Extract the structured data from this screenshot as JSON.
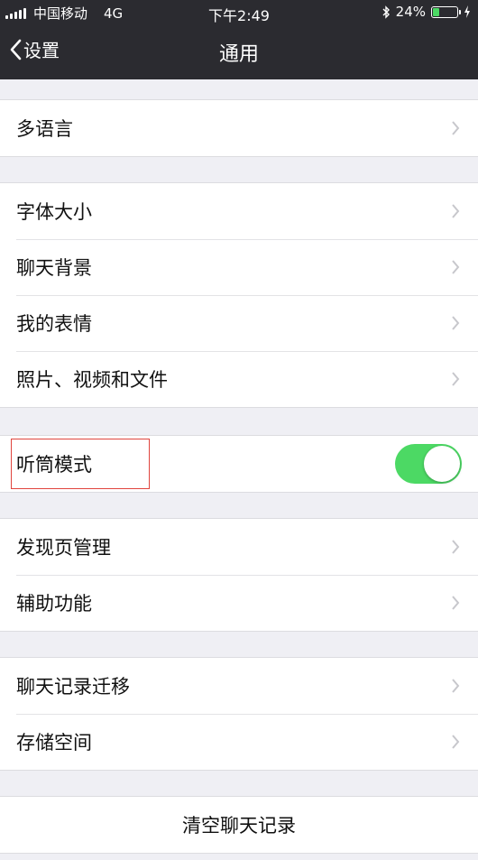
{
  "status_bar": {
    "carrier": "中国移动",
    "network": "4G",
    "time": "下午2:49",
    "battery_percent": "24%",
    "battery_level": 0.24,
    "battery_color": "#4cd964"
  },
  "nav": {
    "back_label": "设置",
    "title": "通用"
  },
  "groups": {
    "g1": {
      "items": [
        {
          "label": "多语言"
        }
      ]
    },
    "g2": {
      "items": [
        {
          "label": "字体大小"
        },
        {
          "label": "聊天背景"
        },
        {
          "label": "我的表情"
        },
        {
          "label": "照片、视频和文件"
        }
      ]
    },
    "g3": {
      "items": [
        {
          "label": "听筒模式",
          "toggle_on": true
        }
      ]
    },
    "g4": {
      "items": [
        {
          "label": "发现页管理"
        },
        {
          "label": "辅助功能"
        }
      ]
    },
    "g5": {
      "items": [
        {
          "label": "聊天记录迁移"
        },
        {
          "label": "存储空间"
        }
      ]
    },
    "g6": {
      "items": [
        {
          "label": "清空聊天记录"
        }
      ]
    }
  },
  "colors": {
    "toggle_on": "#4cd964",
    "highlight": "#e0443d",
    "header_bg": "#2b2b30"
  },
  "icons": [
    "signal-icon",
    "bluetooth-icon",
    "battery-icon",
    "chevron-left-icon",
    "chevron-right-icon"
  ]
}
